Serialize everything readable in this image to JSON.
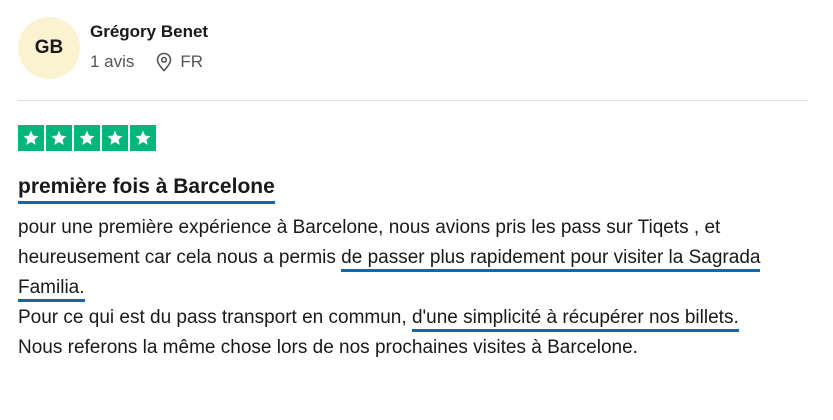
{
  "reviewer": {
    "initials": "GB",
    "name": "Grégory Benet",
    "review_count": "1 avis",
    "country": "FR"
  },
  "rating": {
    "stars": 5,
    "max": 5,
    "color": "#00b67a"
  },
  "review": {
    "title": "première fois à Barcelone",
    "p1_a": "pour une première expérience à Barcelone, nous avions pris les pass sur Tiqets , et heureusement car cela nous a permis ",
    "p1_hl": "de passer plus rapidement pour visiter la Sagrada Familia.",
    "p2_a": "Pour ce qui est du pass transport en commun, ",
    "p2_hl": "d'une simplicité à récupérer nos billets.",
    "p3": "Nous referons la même chose lors de nos prochaines visites à Barcelone."
  },
  "highlight_color": "#1565a8",
  "avatar_color": "#fbf3d0"
}
